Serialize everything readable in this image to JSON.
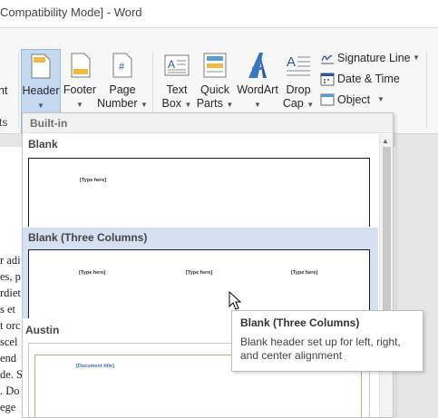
{
  "window": {
    "title": "Compatibility Mode] - Word"
  },
  "ribbon": {
    "left_partial_label": "nt",
    "left_group_partial": "ts",
    "header_button": "Header",
    "footer_button": "Footer",
    "page_number_line1": "Page",
    "page_number_line2": "Number",
    "text_box_line1": "Text",
    "text_box_line2": "Box",
    "quick_parts_line1": "Quick",
    "quick_parts_line2": "Parts",
    "wordart_button": "WordArt",
    "drop_cap_line1": "Drop",
    "drop_cap_line2": "Cap",
    "signature_line": "Signature Line",
    "date_time": "Date & Time",
    "object": "Object"
  },
  "document": {
    "lines": [
      "r adi",
      "es, p",
      "rdiet",
      "s et",
      "t orc",
      "scel",
      "end",
      "de. S",
      ". Do",
      "ege"
    ]
  },
  "gallery": {
    "header": "Built-in",
    "sections": [
      {
        "label": "Blank",
        "placeholders": [
          "[Type here]"
        ]
      },
      {
        "label": "Blank (Three Columns)",
        "placeholders": [
          "[Type here]",
          "[Type here]",
          "[Type here]"
        ]
      },
      {
        "label": "Austin",
        "placeholders": [
          "[Document title]"
        ]
      }
    ]
  },
  "tooltip": {
    "title": "Blank (Three Columns)",
    "description": "Blank header set up for left, right, and center alignment"
  },
  "colors": {
    "accent_blue": "#2b579a",
    "highlight": "#d5e1f2",
    "header_button_bg": "#c5d9f1"
  },
  "icons": [
    "header-icon",
    "footer-icon",
    "page-number-icon",
    "text-box-icon",
    "quick-parts-icon",
    "wordart-icon",
    "drop-cap-icon",
    "signature-line-icon",
    "date-time-icon",
    "object-icon",
    "pointer-cursor-icon"
  ]
}
